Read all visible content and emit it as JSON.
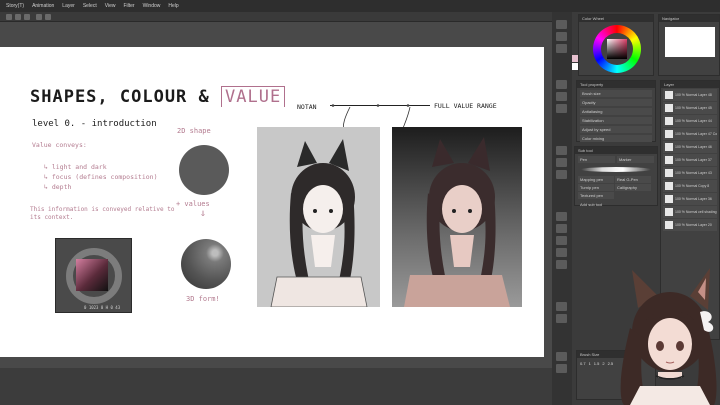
{
  "menu": {
    "items": [
      "Story(T)",
      "Animation",
      "Layer",
      "Select",
      "View",
      "Filter",
      "Window",
      "Help"
    ]
  },
  "slide": {
    "title": "SHAPES, COLOUR &",
    "title_value": "VALUE",
    "subtitle": "level 0. - introduction",
    "conveys_label": "Value conveys:",
    "conveys_items": [
      "light and dark",
      "focus (defines composition)",
      "depth"
    ],
    "note": "This information is conveyed relative to its context.",
    "label_2d": "2D shape",
    "label_values": "+ values",
    "label_3d": "3D form!",
    "notan": "NOTAN",
    "full_range": "FULL VALUE RANGE"
  },
  "dock": {
    "color_panel_title": "Color Wheel",
    "navigator_title": "Navigator",
    "brush_title": "Tool property",
    "brush_rows": [
      "Brush size",
      "Opacity",
      "Antialiasing",
      "Stabilization",
      "Adjust by speed",
      "Color mixing"
    ],
    "subtool_title": "Sub tool",
    "subtool_tabs": [
      "Pen",
      "Marker"
    ],
    "subtool_items": [
      "Mapping pen",
      "Real G-Pen",
      "Turnip pen",
      "Calligraphy",
      "Textured pen"
    ],
    "subtool_add": "Add sub tool",
    "layers_title": "Layer",
    "layers": [
      "100 % Normal Layer 48",
      "100 % Normal Layer 45",
      "100 % Normal Layer 44",
      "100 % Normal Layer 47 Copy",
      "100 % Normal Layer 46",
      "100 % Normal Layer 37",
      "100 % Normal Layer 43",
      "100 % Normal Copy 8",
      "100 % Normal Layer 36",
      "100 % Normal cell shading",
      "100 % Normal Layer 20"
    ],
    "brushsize_title": "Brush Size",
    "brush_sizes": [
      "0.7",
      "1",
      "1.5",
      "2",
      "2.5"
    ]
  },
  "screenshot_caption": "0 1023  0 H  0 43"
}
